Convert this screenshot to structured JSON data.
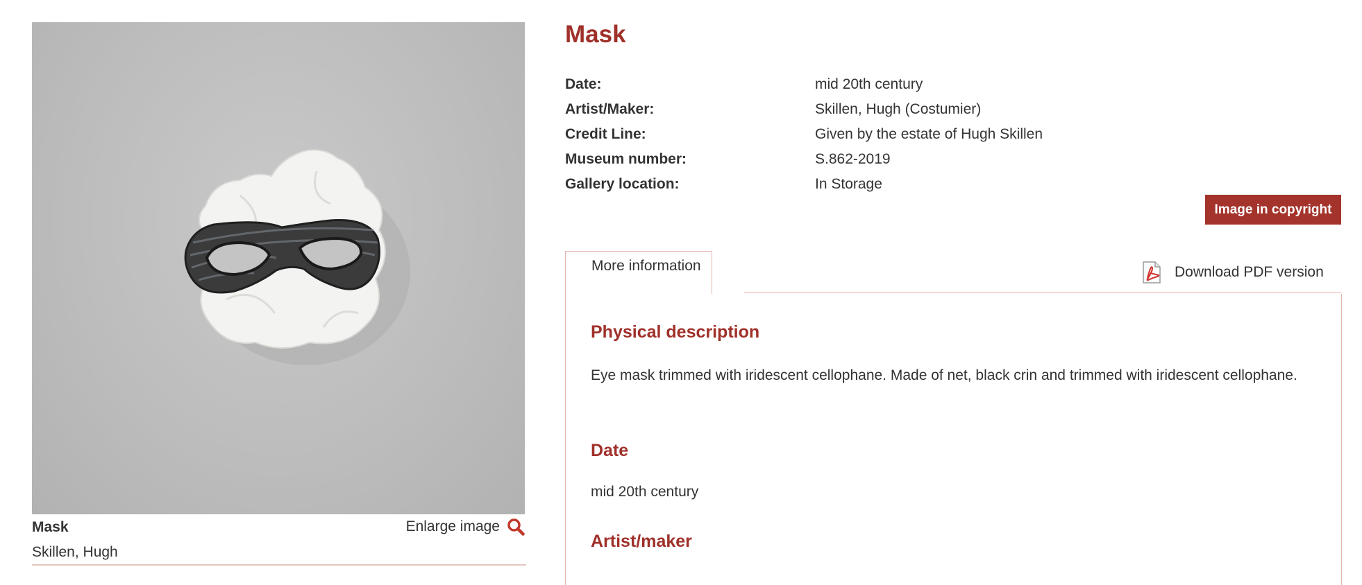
{
  "image": {
    "alt": "Mask",
    "caption_title": "Mask",
    "caption_maker": "Skillen, Hugh",
    "enlarge_label": "Enlarge image"
  },
  "object": {
    "title": "Mask",
    "meta": [
      {
        "label": "Date:",
        "value": "mid 20th century"
      },
      {
        "label": "Artist/Maker:",
        "value": "Skillen, Hugh (Costumier)"
      },
      {
        "label": "Credit Line:",
        "value": "Given by the estate of Hugh Skillen"
      },
      {
        "label": "Museum number:",
        "value": "S.862-2019"
      },
      {
        "label": "Gallery location:",
        "value": "In Storage"
      }
    ],
    "copyright_label": "Image in copyright"
  },
  "tabs": {
    "more_info_label": "More information",
    "pdf_label": "Download PDF version"
  },
  "sections": {
    "physical_heading": "Physical description",
    "physical_text": "Eye mask trimmed with iridescent cellophane. Made of net, black crin and trimmed with iridescent cellophane.",
    "date_heading": "Date",
    "date_text": "mid 20th century",
    "artist_heading": "Artist/maker"
  },
  "colors": {
    "accent": "#a0302a",
    "border": "#e3b3ad",
    "text": "#333333"
  }
}
